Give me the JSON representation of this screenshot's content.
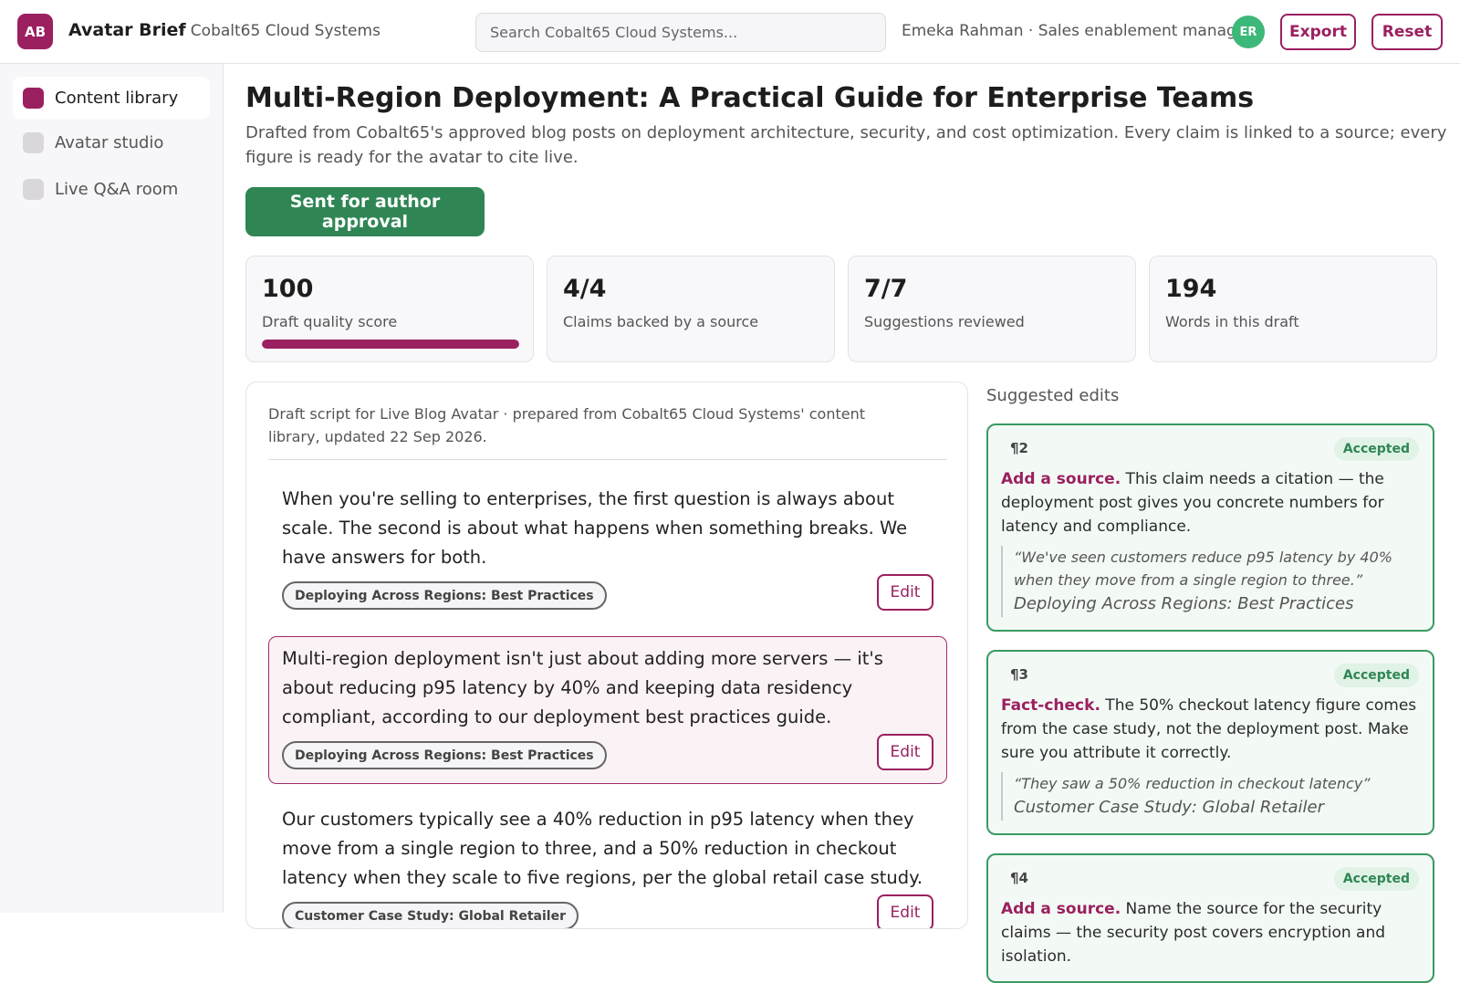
{
  "app": {
    "logo_initials": "AB",
    "title": "Avatar Brief",
    "org": "· Cobalt65 Cloud Systems"
  },
  "search": {
    "placeholder": "Search Cobalt65 Cloud Systems..."
  },
  "user": {
    "label": "Emeka Rahman · Sales enablement manager",
    "initials": "ER"
  },
  "toolbar": {
    "export_label": "Export",
    "reset_label": "Reset"
  },
  "sidebar": {
    "items": [
      {
        "label": "Content library",
        "active": true
      },
      {
        "label": "Avatar studio",
        "active": false
      },
      {
        "label": "Live Q&A room",
        "active": false
      }
    ]
  },
  "page": {
    "title": "Multi-Region Deployment: A Practical Guide for Enterprise Teams",
    "subtitle": "Drafted from Cobalt65's approved blog posts on deployment architecture, security, and cost optimization. Every claim is linked to a source; every figure is ready for the avatar to cite live.",
    "status_label": "Sent for author approval"
  },
  "stats": [
    {
      "value": "100",
      "label": "Draft quality score",
      "progress": 1.0
    },
    {
      "value": "4/4",
      "label": "Claims backed by a source"
    },
    {
      "value": "7/7",
      "label": "Suggestions reviewed"
    },
    {
      "value": "194",
      "label": "Words in this draft"
    }
  ],
  "draft": {
    "meta": "Draft script for Live Blog Avatar · prepared from Cobalt65 Cloud Systems' content library, updated 22 Sep 2026.",
    "edit_label": "Edit",
    "paragraphs": [
      {
        "text": "When you're selling to enterprises, the first question is always about scale. The second is about what happens when something breaks. We have answers for both.",
        "source": "Deploying Across Regions: Best Practices",
        "highlighted": false
      },
      {
        "text": "Multi-region deployment isn't just about adding more servers — it's about reducing p95 latency by 40% and keeping data residency compliant, according to our deployment best practices guide.",
        "source": "Deploying Across Regions: Best Practices",
        "highlighted": true
      },
      {
        "text": "Our customers typically see a 40% reduction in p95 latency when they move from a single region to three, and a 50% reduction in checkout latency when they scale to five regions, per the global retail case study.",
        "source": "Customer Case Study: Global Retailer",
        "highlighted": false
      }
    ]
  },
  "suggestions": {
    "heading": "Suggested edits",
    "items": [
      {
        "ref": "¶2",
        "status": "Accepted",
        "kind": "Add a source.",
        "body": " This claim needs a citation — the deployment post gives you concrete numbers for latency and compliance.",
        "quote": "“We've seen customers reduce p95 latency by 40% when they move from a single region to three.”",
        "quote_source": "Deploying Across Regions: Best Practices"
      },
      {
        "ref": "¶3",
        "status": "Accepted",
        "kind": "Fact-check.",
        "body": " The 50% checkout latency figure comes from the case study, not the deployment post. Make sure you attribute it correctly.",
        "quote": "“They saw a 50% reduction in checkout latency”",
        "quote_source": "Customer Case Study: Global Retailer"
      },
      {
        "ref": "¶4",
        "status": "Accepted",
        "kind": "Add a source.",
        "body": " Name the source for the security claims — the security post covers encryption and isolation.",
        "quote": "",
        "quote_source": ""
      }
    ]
  },
  "colors": {
    "accent": "#9b2060",
    "success": "#2f8654",
    "avatar_user": "#3cb878"
  }
}
